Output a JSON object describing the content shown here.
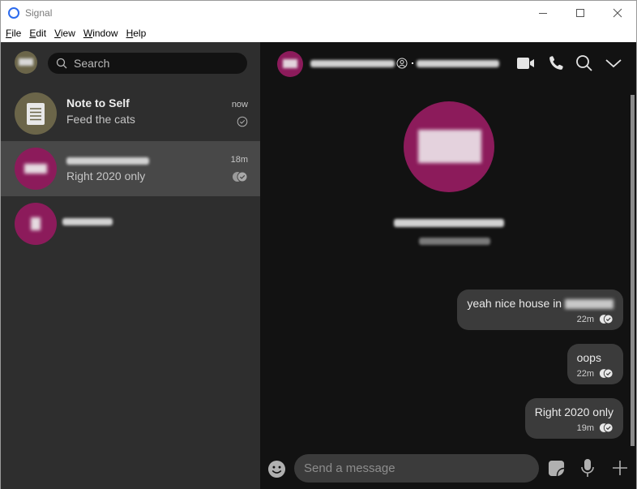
{
  "window": {
    "title": "Signal",
    "controls": {
      "minimize": "minimize",
      "maximize": "maximize",
      "close": "close"
    }
  },
  "menu": [
    "File",
    "Edit",
    "View",
    "Window",
    "Help"
  ],
  "sidebar": {
    "search": {
      "placeholder": "Search",
      "value": ""
    },
    "conversations": [
      {
        "name": "Note to Self",
        "preview": "Feed the cats",
        "time": "now",
        "status": "sent",
        "avatar": "note-icon",
        "active": false
      },
      {
        "name": "[redacted]",
        "preview": "Right 2020 only",
        "time": "18m",
        "status": "read",
        "avatar": "redacted",
        "active": true
      },
      {
        "name": "[redacted]",
        "preview": "",
        "time": "",
        "status": "",
        "avatar": "redacted",
        "active": false
      }
    ]
  },
  "chat": {
    "header": {
      "contact_name": "[redacted]",
      "icons": [
        "video-call-icon",
        "voice-call-icon",
        "search-icon",
        "chevron-down-icon"
      ]
    },
    "messages": [
      {
        "text": "yeah nice house in",
        "redacted_suffix": true,
        "time": "22m",
        "status": "read"
      },
      {
        "text": "oops",
        "time": "22m",
        "status": "read"
      },
      {
        "text": "Right 2020 only",
        "time": "19m",
        "status": "read"
      }
    ],
    "composer": {
      "placeholder": "Send a message",
      "value": ""
    }
  },
  "colors": {
    "accent": "#2c6bed",
    "avatar": "#8c1b5b",
    "note_avatar": "#6b6549",
    "bubble": "#3b3b3b",
    "sidebar": "#2e2e2e",
    "chat_bg": "#121212"
  }
}
